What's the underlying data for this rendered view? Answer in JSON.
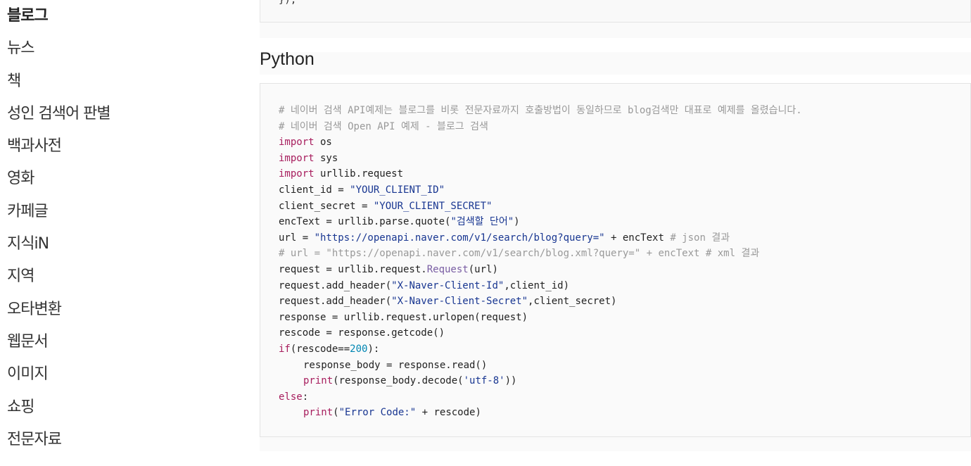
{
  "sidebar": {
    "items": [
      {
        "label": "블로그",
        "active": true
      },
      {
        "label": "뉴스"
      },
      {
        "label": "책"
      },
      {
        "label": "성인 검색어 판별"
      },
      {
        "label": "백과사전"
      },
      {
        "label": "영화"
      },
      {
        "label": "카페글"
      },
      {
        "label": "지식iN"
      },
      {
        "label": "지역"
      },
      {
        "label": "오타변환"
      },
      {
        "label": "웹문서"
      },
      {
        "label": "이미지"
      },
      {
        "label": "쇼핑"
      },
      {
        "label": "전문자료"
      }
    ]
  },
  "main": {
    "prev_code_tail": "});",
    "section_title": "Python",
    "code": {
      "l1": "# 네이버 검색 API예제는 블로그를 비롯 전문자료까지 호출방법이 동일하므로 blog검색만 대표로 예제를 올렸습니다.",
      "l2": "# 네이버 검색 Open API 예제 - 블로그 검색",
      "kw_import": "import",
      "l3_rest": " os",
      "l4_rest": " sys",
      "l5_rest": " urllib.request",
      "l6a": "client_id = ",
      "l6s": "\"YOUR_CLIENT_ID\"",
      "l7a": "client_secret = ",
      "l7s": "\"YOUR_CLIENT_SECRET\"",
      "l8a": "encText = urllib.parse.quote(",
      "l8s": "\"검색할 단어\"",
      "l8b": ")",
      "l9a": "url = ",
      "l9s": "\"https://openapi.naver.com/v1/search/blog?query=\"",
      "l9b": " + encText ",
      "l9c": "# json 결과",
      "l10": "# url = \"https://openapi.naver.com/v1/search/blog.xml?query=\" + encText # xml 결과",
      "l11a": "request = urllib.request.",
      "l11f": "Request",
      "l11b": "(url)",
      "l12a": "request.add_header(",
      "l12s": "\"X-Naver-Client-Id\"",
      "l12b": ",client_id)",
      "l13a": "request.add_header(",
      "l13s": "\"X-Naver-Client-Secret\"",
      "l13b": ",client_secret)",
      "l14": "response = urllib.request.urlopen(request)",
      "l15": "rescode = response.getcode()",
      "l16k": "if",
      "l16a": "(rescode==",
      "l16n": "200",
      "l16b": "):",
      "l17": "response_body = response.read()",
      "kw_print": "print",
      "l18a": "(response_body.decode(",
      "l18s": "'utf-8'",
      "l18b": "))",
      "l19k": "else",
      "l19b": ":",
      "l20a": "(",
      "l20s": "\"Error Code:\"",
      "l20b": " + rescode)"
    }
  },
  "colors": {
    "comment": "#999999",
    "keyword": "#a71d5d",
    "string": "#183691",
    "number": "#0086b3",
    "function": "#795da3",
    "code_bg": "#fafafa"
  }
}
